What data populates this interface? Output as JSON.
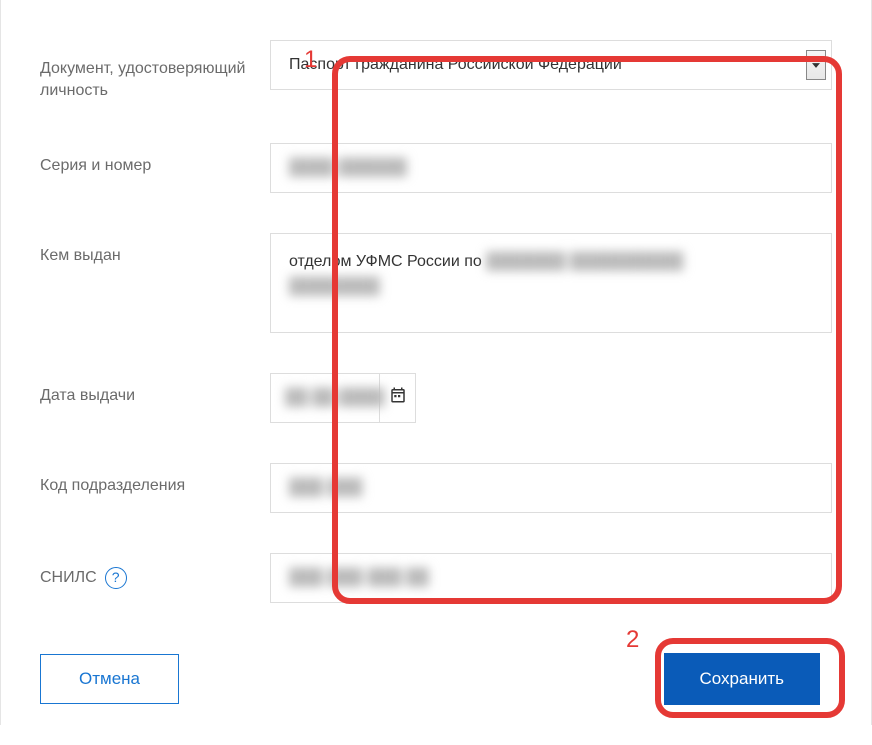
{
  "annotations": {
    "marker1": "1",
    "marker2": "2"
  },
  "labels": {
    "document": "Документ, удостоверяющий личность",
    "series": "Серия и номер",
    "issued_by": "Кем выдан",
    "issue_date": "Дата выдачи",
    "dept_code": "Код подразделения",
    "snils": "СНИЛС"
  },
  "values": {
    "document_type": "Паспорт гражданина Российской Федерации",
    "series_number": "████ ██████",
    "issued_by_prefix": "отделом УФМС России по ",
    "issued_by_redacted1": "███████ ██████████",
    "issued_by_redacted2": "████████",
    "issue_date": "██.██.████",
    "dept_code": "███-███",
    "snils": "███-███-███ ██"
  },
  "buttons": {
    "cancel": "Отмена",
    "save": "Сохранить"
  },
  "help_glyph": "?"
}
